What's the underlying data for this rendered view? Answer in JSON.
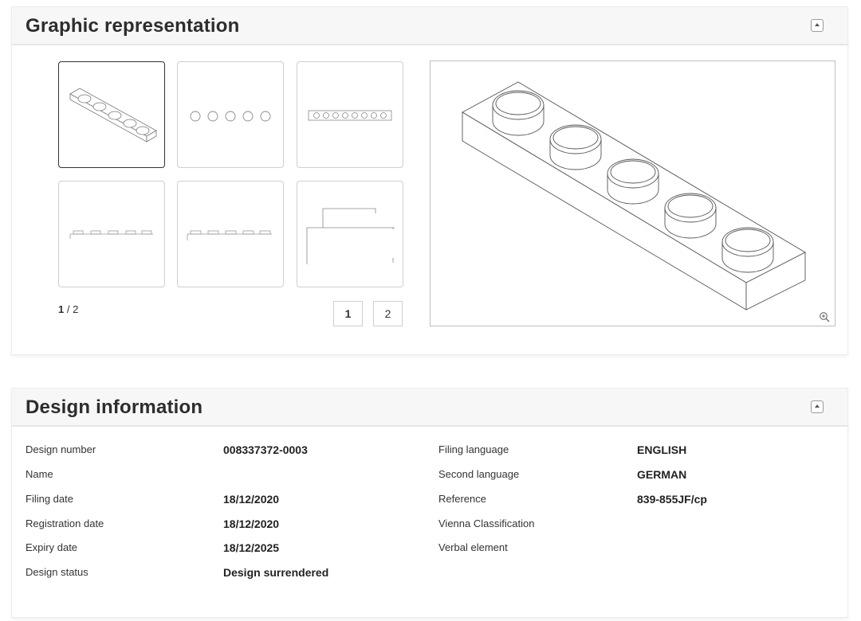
{
  "graphic_panel": {
    "title": "Graphic representation",
    "pager": {
      "current": "1",
      "separator": " / ",
      "total": "2"
    },
    "pages": [
      "1",
      "2"
    ]
  },
  "design_panel": {
    "title": "Design information",
    "left": [
      {
        "label": "Design number",
        "value": "008337372-0003"
      },
      {
        "label": "Name",
        "value": ""
      },
      {
        "label": "Filing date",
        "value": "18/12/2020"
      },
      {
        "label": "Registration date",
        "value": "18/12/2020"
      },
      {
        "label": "Expiry date",
        "value": "18/12/2025"
      },
      {
        "label": "Design status",
        "value": "Design surrendered"
      }
    ],
    "right": [
      {
        "label": "Filing language",
        "value": "ENGLISH"
      },
      {
        "label": "Second language",
        "value": "GERMAN"
      },
      {
        "label": "Reference",
        "value": "839-855JF/cp"
      },
      {
        "label": "Vienna Classification",
        "value": ""
      },
      {
        "label": "Verbal element",
        "value": ""
      }
    ]
  },
  "icons": {
    "collapse": "caret-up-icon",
    "zoom": "zoom-in-icon"
  }
}
